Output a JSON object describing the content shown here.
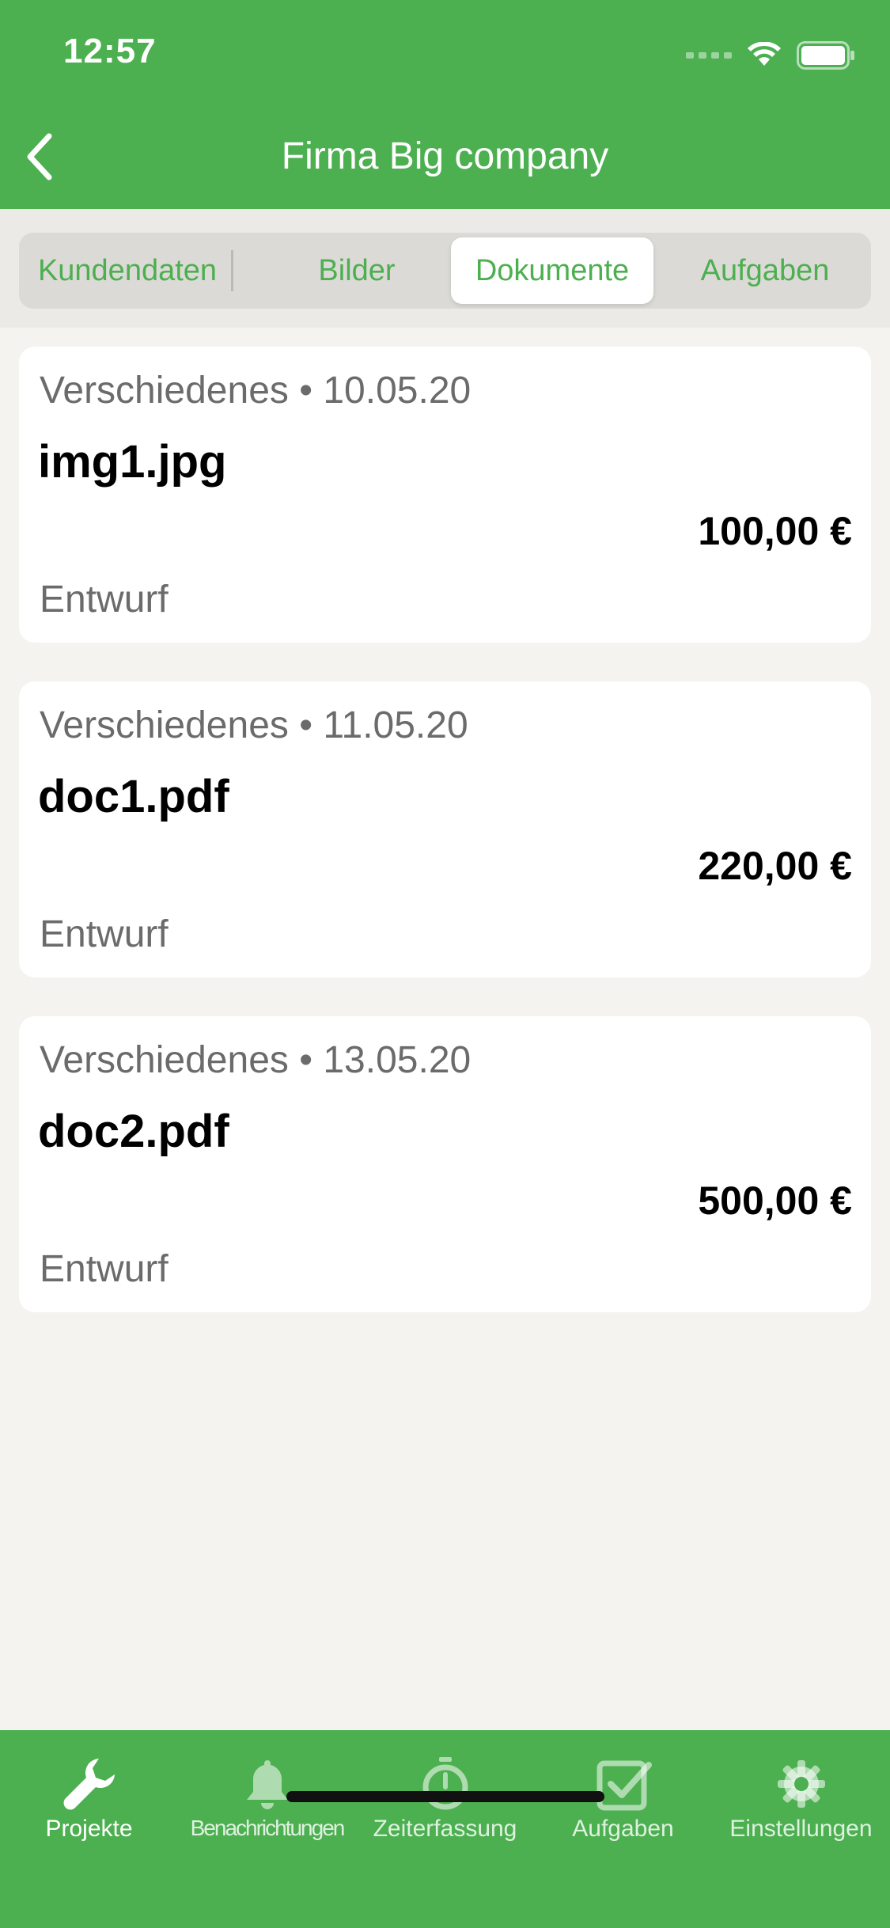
{
  "status_bar": {
    "time": "12:57"
  },
  "nav": {
    "title": "Firma Big company",
    "back_icon": "chevron-left-icon"
  },
  "segments": {
    "items": [
      {
        "label": "Kundendaten",
        "active": false
      },
      {
        "label": "Bilder",
        "active": false
      },
      {
        "label": "Dokumente",
        "active": true
      },
      {
        "label": "Aufgaben",
        "active": false
      }
    ]
  },
  "documents": [
    {
      "category": "Verschiedenes",
      "date": "10.05.20",
      "meta": "Verschiedenes • 10.05.20",
      "name": "img1.jpg",
      "amount": "100,00 €",
      "status": "Entwurf"
    },
    {
      "category": "Verschiedenes",
      "date": "11.05.20",
      "meta": "Verschiedenes • 11.05.20",
      "name": "doc1.pdf",
      "amount": "220,00 €",
      "status": "Entwurf"
    },
    {
      "category": "Verschiedenes",
      "date": "13.05.20",
      "meta": "Verschiedenes • 13.05.20",
      "name": "doc2.pdf",
      "amount": "500,00 €",
      "status": "Entwurf"
    }
  ],
  "tabbar": {
    "items": [
      {
        "label": "Projekte",
        "icon": "wrench-icon",
        "active": true
      },
      {
        "label": "Benachrichtungen",
        "icon": "bell-icon",
        "active": false
      },
      {
        "label": "Zeiterfassung",
        "icon": "stopwatch-icon",
        "active": false
      },
      {
        "label": "Aufgaben",
        "icon": "checkbox-icon",
        "active": false
      },
      {
        "label": "Einstellungen",
        "icon": "gear-icon",
        "active": false
      }
    ]
  },
  "colors": {
    "brand_green": "#4caf50",
    "background": "#f4f3f0",
    "card": "#ffffff",
    "muted_text": "#6b6b6b"
  }
}
